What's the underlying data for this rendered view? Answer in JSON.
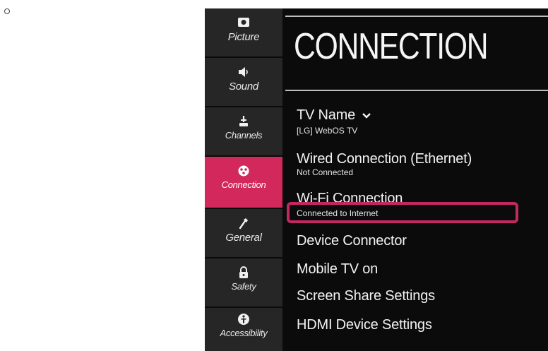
{
  "sidebar": {
    "items": [
      {
        "label": "Picture",
        "icon": "picture-icon"
      },
      {
        "label": "Sound",
        "icon": "speaker-icon"
      },
      {
        "label": "Channels",
        "icon": "antenna-icon"
      },
      {
        "label": "Connection",
        "icon": "connection-icon",
        "active": true
      },
      {
        "label": "General",
        "icon": "wrench-icon"
      },
      {
        "label": "Safety",
        "icon": "lock-icon"
      },
      {
        "label": "Accessibility",
        "icon": "accessibility-icon"
      }
    ]
  },
  "main": {
    "title": "CONNECTION",
    "items": [
      {
        "label": "TV Name",
        "value": "[LG] WebOS TV"
      },
      {
        "label": "Wired Connection (Ethernet)",
        "value": "Not Connected"
      },
      {
        "label": "Wi-Fi Connection",
        "value": "Connected to Internet"
      },
      {
        "label": "Device Connector"
      },
      {
        "label": "Mobile TV on"
      },
      {
        "label": "Screen Share Settings"
      },
      {
        "label": "HDMI Device Settings"
      }
    ]
  },
  "colors": {
    "accent": "#d2285c",
    "highlight_border": "#c42860",
    "background": "#0b0b0b",
    "sidebar_bg": "#262626"
  }
}
